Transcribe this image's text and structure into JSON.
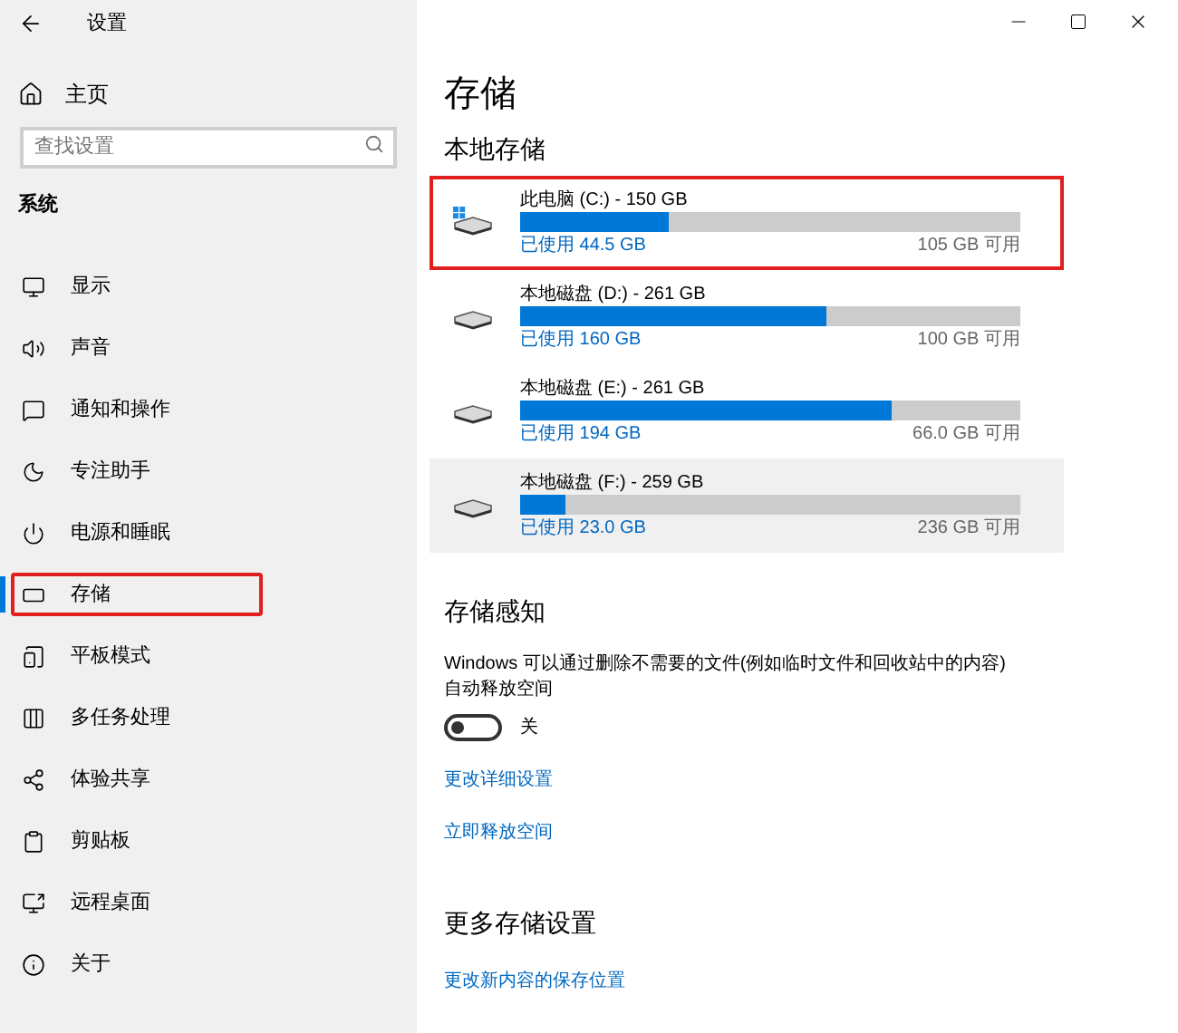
{
  "window": {
    "title": "设置"
  },
  "sidebar": {
    "home": "主页",
    "search": {
      "placeholder": "查找设置"
    },
    "section": "系统",
    "items": [
      {
        "label": "显示",
        "kind": "display",
        "selected": false,
        "highlighted": false
      },
      {
        "label": "声音",
        "kind": "sound",
        "selected": false,
        "highlighted": false
      },
      {
        "label": "通知和操作",
        "kind": "notify",
        "selected": false,
        "highlighted": false
      },
      {
        "label": "专注助手",
        "kind": "focus",
        "selected": false,
        "highlighted": false
      },
      {
        "label": "电源和睡眠",
        "kind": "power",
        "selected": false,
        "highlighted": false
      },
      {
        "label": "存储",
        "kind": "storage",
        "selected": true,
        "highlighted": true
      },
      {
        "label": "平板模式",
        "kind": "tablet",
        "selected": false,
        "highlighted": false
      },
      {
        "label": "多任务处理",
        "kind": "multitask",
        "selected": false,
        "highlighted": false
      },
      {
        "label": "体验共享",
        "kind": "share",
        "selected": false,
        "highlighted": false
      },
      {
        "label": "剪贴板",
        "kind": "clipboard",
        "selected": false,
        "highlighted": false
      },
      {
        "label": "远程桌面",
        "kind": "remote",
        "selected": false,
        "highlighted": false
      },
      {
        "label": "关于",
        "kind": "about",
        "selected": false,
        "highlighted": false
      }
    ]
  },
  "page_title": "存储",
  "local_storage": {
    "heading": "本地存储",
    "drives": [
      {
        "name": "此电脑 (C:) - 150 GB",
        "kind": "system",
        "used": "已使用 44.5 GB",
        "free": "105 GB 可用",
        "level": 0.297,
        "highlighted": true,
        "hovered": false
      },
      {
        "name": "本地磁盘 (D:) - 261 GB",
        "kind": "disk",
        "used": "已使用 160 GB",
        "free": "100 GB 可用",
        "level": 0.613,
        "highlighted": false,
        "hovered": false
      },
      {
        "name": "本地磁盘 (E:) - 261 GB",
        "kind": "disk",
        "used": "已使用 194 GB",
        "free": "66.0 GB 可用",
        "level": 0.743,
        "highlighted": false,
        "hovered": false
      },
      {
        "name": "本地磁盘 (F:) - 259 GB",
        "kind": "disk",
        "used": "已使用 23.0 GB",
        "free": "236 GB 可用",
        "level": 0.089,
        "highlighted": false,
        "hovered": true
      }
    ]
  },
  "storage_sense": {
    "heading": "存储感知",
    "description": "Windows 可以通过删除不需要的文件(例如临时文件和回收站中的内容)自动释放空间",
    "toggle": {
      "on": false,
      "label": "关"
    },
    "links": [
      "更改详细设置",
      "立即释放空间"
    ]
  },
  "more_settings": {
    "heading": "更多存储设置",
    "links": [
      "更改新内容的保存位置"
    ]
  }
}
